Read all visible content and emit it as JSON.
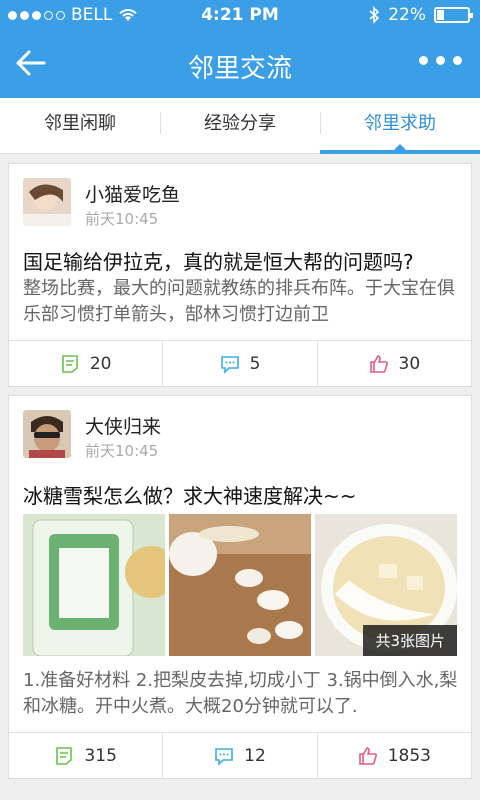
{
  "status": {
    "carrier": "BELL",
    "time": "4:21 PM",
    "battery": "22%",
    "battery_level": 0.22
  },
  "nav": {
    "title": "邻里交流",
    "back_icon": "back-arrow-icon",
    "more_icon": "more-icon"
  },
  "tabs": [
    {
      "label": "邻里闲聊",
      "active": false
    },
    {
      "label": "经验分享",
      "active": false
    },
    {
      "label": "邻里求助",
      "active": true
    }
  ],
  "posts": [
    {
      "user": "小猫爱吃鱼",
      "time": "前天10:45",
      "title": "国足输给伊拉克，真的就是恒大帮的问题吗?",
      "body": "整场比赛，最大的问题就教练的排兵布阵。于大宝在俱乐部习惯打单箭头，郜林习惯打边前卫",
      "reads": "20",
      "comments": "5",
      "likes": "30"
    },
    {
      "user": "大侠归来",
      "time": "前天10:45",
      "title": "冰糖雪梨怎么做？求大神速度解决~~",
      "photo_count_label": "共3张图片",
      "body": "1.准备好材料 2.把梨皮去掉,切成小丁 3.锅中倒入水,梨和冰糖。开中火煮。大概20分钟就可以了.",
      "reads": "315",
      "comments": "12",
      "likes": "1853"
    }
  ],
  "colors": {
    "brand": "#3b9fe8",
    "read_icon": "#6cc24a",
    "comment_icon": "#3ab0e0",
    "like_icon": "#e25a8a"
  }
}
